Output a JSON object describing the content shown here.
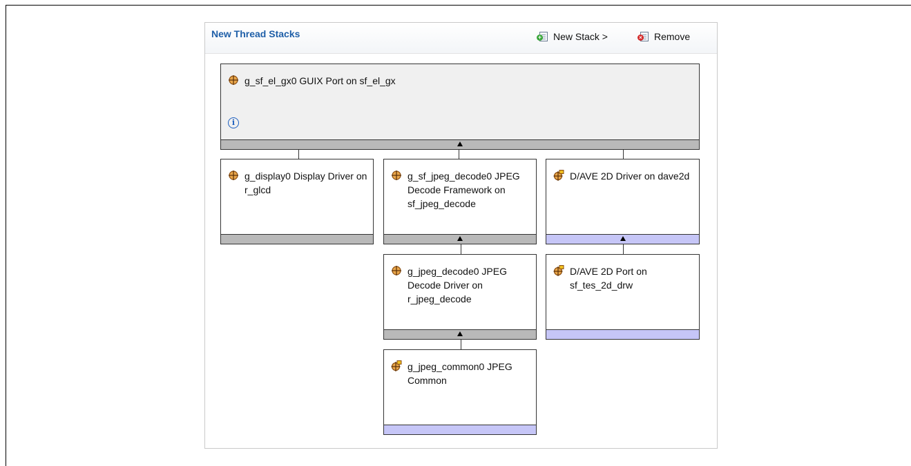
{
  "panel": {
    "title": "New Thread Stacks",
    "new_stack_label": "New Stack >",
    "remove_label": "Remove"
  },
  "modules": {
    "guix_port": {
      "label": "g_sf_el_gx0 GUIX Port on sf_el_gx",
      "icon": "module-crosshair-icon",
      "info_icon": "info-icon"
    },
    "display": {
      "label": "g_display0 Display Driver on r_glcd",
      "icon": "module-crosshair-icon"
    },
    "jpeg_framework": {
      "label": "g_sf_jpeg_decode0 JPEG Decode Framework on sf_jpeg_decode",
      "icon": "module-crosshair-icon"
    },
    "dave_driver": {
      "label": "D/AVE 2D Driver on dave2d",
      "icon": "module-flag-icon"
    },
    "jpeg_driver": {
      "label": "g_jpeg_decode0 JPEG Decode Driver on r_jpeg_decode",
      "icon": "module-crosshair-icon"
    },
    "dave_port": {
      "label": "D/AVE 2D Port on sf_tes_2d_drw",
      "icon": "module-flag-icon"
    },
    "jpeg_common": {
      "label": "g_jpeg_common0 JPEG Common",
      "icon": "module-flag-icon"
    }
  },
  "colors": {
    "title": "#1f5fa8",
    "bar_gray": "#b9b9b9",
    "bar_blue": "#c6c6f7",
    "icon_orange": "#c8781e"
  }
}
